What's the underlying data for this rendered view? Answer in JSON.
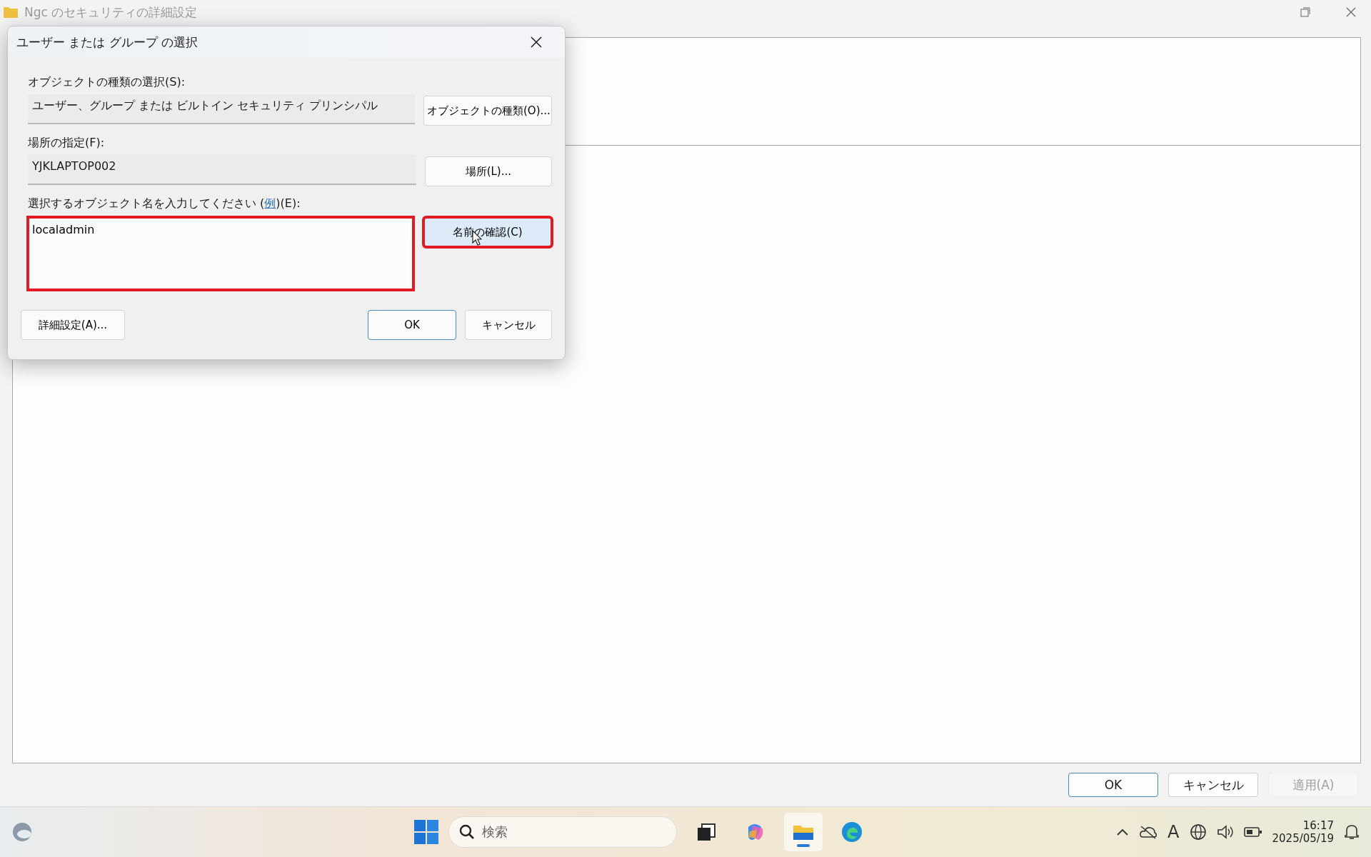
{
  "window": {
    "title": "Ngc のセキュリティの詳細設定"
  },
  "dialog": {
    "title": "ユーザー または グループ の選択",
    "object_type": {
      "label": "オブジェクトの種類の選択(S):",
      "value": "ユーザー、グループ または ビルトイン セキュリティ プリンシパル",
      "button": "オブジェクトの種類(O)..."
    },
    "location": {
      "label": "場所の指定(F):",
      "value": "YJKLAPTOP002",
      "button": "場所(L)..."
    },
    "names": {
      "label_before": "選択するオブジェクト名を入力してください (",
      "link": "例",
      "label_after": ")(E):",
      "value": "localadmin",
      "highlighted": true
    },
    "check_button": {
      "label": "名前の確認(C)",
      "highlighted": true,
      "hovered": true
    },
    "buttons": [
      {
        "label": "詳細設定(A)...",
        "default": false
      },
      {
        "label": "OK",
        "default": true
      },
      {
        "label": "キャンセル",
        "default": false
      }
    ]
  },
  "footer_buttons": [
    {
      "label": "OK",
      "default": true,
      "disabled": false
    },
    {
      "label": "キャンセル",
      "default": false,
      "disabled": false
    },
    {
      "label": "適用(A)",
      "default": false,
      "disabled": true
    }
  ],
  "taskbar": {
    "search_placeholder": "検索",
    "apps": [
      {
        "kind": "taskview",
        "active": false
      },
      {
        "kind": "copilot",
        "active": false
      },
      {
        "kind": "explorer",
        "active": true
      },
      {
        "kind": "edge",
        "active": false
      }
    ],
    "ime": "A",
    "time": "16:17",
    "date": "2025/05/19"
  }
}
